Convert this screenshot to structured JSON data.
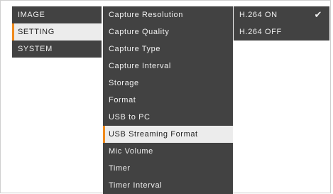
{
  "main_menu": {
    "items": [
      {
        "label": "IMAGE"
      },
      {
        "label": "SETTING"
      },
      {
        "label": "SYSTEM"
      }
    ],
    "selected_index": 1
  },
  "setting_menu": {
    "items": [
      {
        "label": "Capture Resolution"
      },
      {
        "label": "Capture Quality"
      },
      {
        "label": "Capture Type"
      },
      {
        "label": "Capture Interval"
      },
      {
        "label": "Storage"
      },
      {
        "label": "Format"
      },
      {
        "label": "USB to PC"
      },
      {
        "label": "USB Streaming Format"
      },
      {
        "label": "Mic Volume"
      },
      {
        "label": "Timer"
      },
      {
        "label": "Timer Interval"
      }
    ],
    "selected_index": 7
  },
  "option_menu": {
    "items": [
      {
        "label": "H.264 ON",
        "checked": true
      },
      {
        "label": "H.264 OFF",
        "checked": false
      }
    ],
    "check_glyph": "✔"
  },
  "colors": {
    "panel": "#424242",
    "highlight": "#ececec",
    "accent": "#f08a1c"
  }
}
